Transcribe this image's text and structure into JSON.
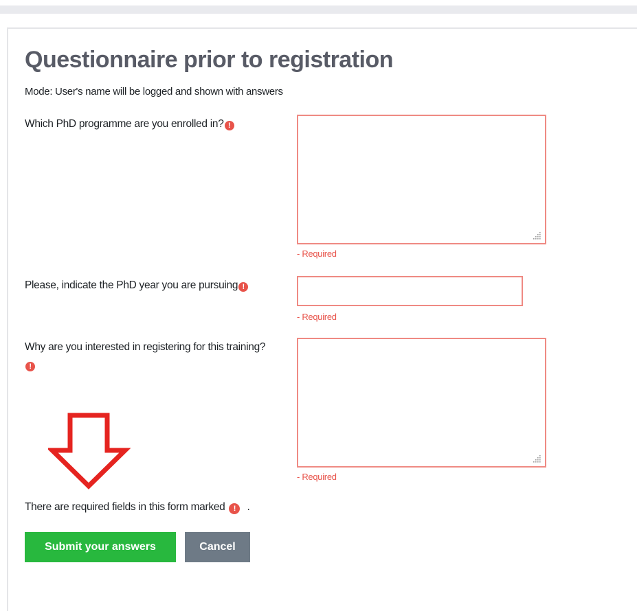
{
  "form": {
    "title": "Questionnaire prior to registration",
    "mode_text": "Mode: User's name will be logged and shown with answers",
    "required_icon_glyph": "!",
    "questions": [
      {
        "label": "Which PhD programme are you enrolled in?",
        "type": "textarea",
        "value": "",
        "required_note": "- Required"
      },
      {
        "label": "Please, indicate the PhD year you are pursuing",
        "type": "text",
        "value": "",
        "required_note": "- Required"
      },
      {
        "label": "Why are you interested in registering for this training?",
        "type": "textarea",
        "value": "",
        "required_note": "- Required"
      }
    ],
    "required_fields_note": "There are required fields in this form marked",
    "required_fields_period": ".",
    "submit_label": "Submit your answers",
    "cancel_label": "Cancel"
  },
  "annotation": {
    "icon": "arrow-down-icon",
    "color": "#e52420"
  },
  "colors": {
    "title": "#585b66",
    "required": "#e8534a",
    "field_border": "#ef8a83",
    "submit_bg": "#28b83e",
    "cancel_bg": "#6e7a86"
  }
}
